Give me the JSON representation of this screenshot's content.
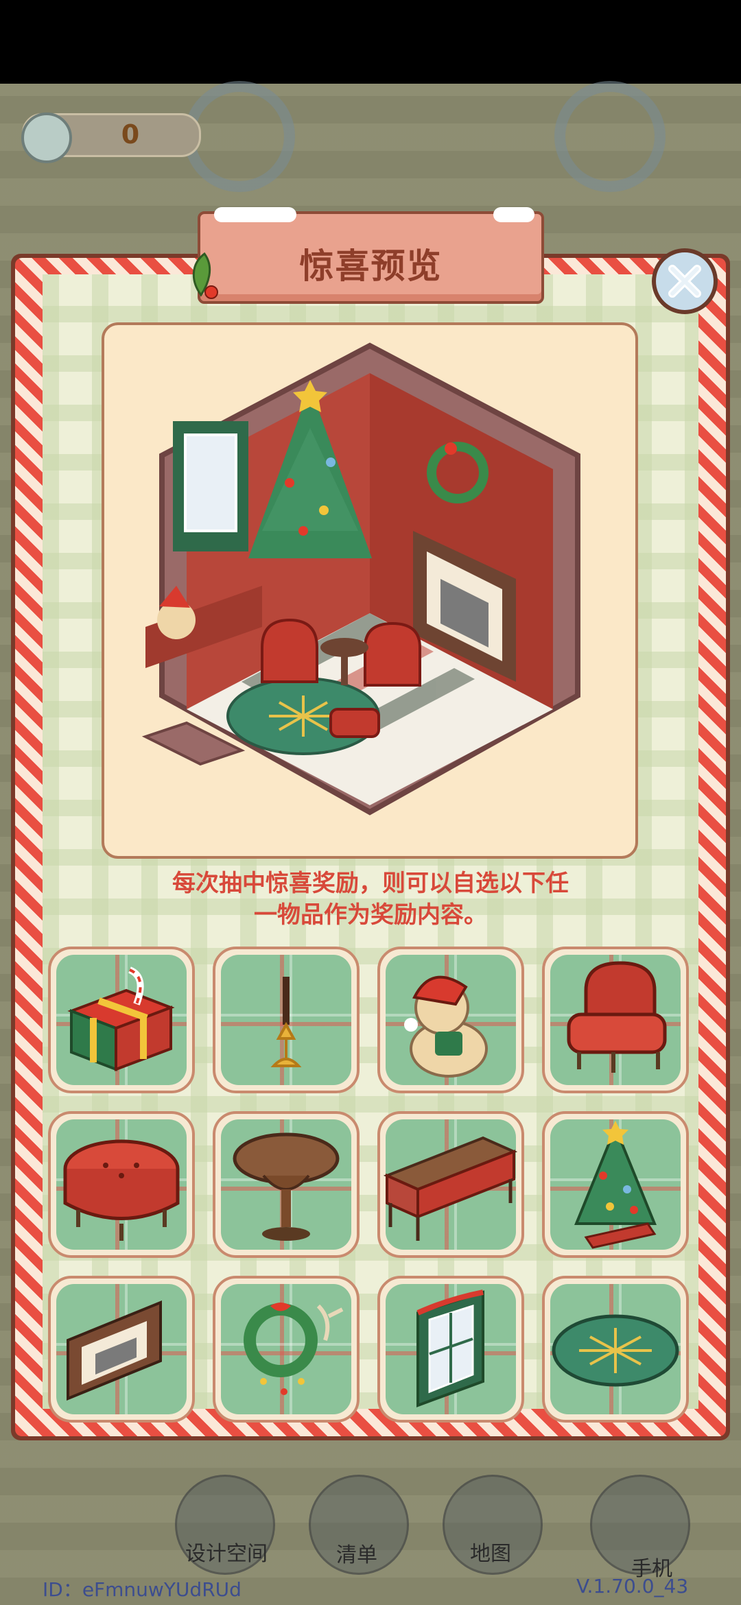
{
  "hud": {
    "snail_count": "0"
  },
  "modal": {
    "title": "惊喜预览",
    "description_line1": "每次抽中惊喜奖励，则可以自选以下任",
    "description_line2": "一物品作为奖励内容。",
    "items": [
      {
        "name": "gift-box-icon"
      },
      {
        "name": "candlestick-icon"
      },
      {
        "name": "teddy-bear-icon"
      },
      {
        "name": "armchair-icon"
      },
      {
        "name": "ottoman-icon"
      },
      {
        "name": "round-table-icon"
      },
      {
        "name": "desk-icon"
      },
      {
        "name": "christmas-tree-icon"
      },
      {
        "name": "fireplace-icon"
      },
      {
        "name": "wreath-icon"
      },
      {
        "name": "window-curtain-icon"
      },
      {
        "name": "round-rug-icon"
      }
    ]
  },
  "bottom_nav": {
    "design": "设计空间",
    "list": "清单",
    "map": "地图",
    "phone": "手机"
  },
  "footer": {
    "id": "ID：eFmnuwYUdRUd",
    "version": "V.1.70.0_43"
  },
  "colors": {
    "accent_red": "#d8493a",
    "title_brown": "#8e3e2a"
  }
}
